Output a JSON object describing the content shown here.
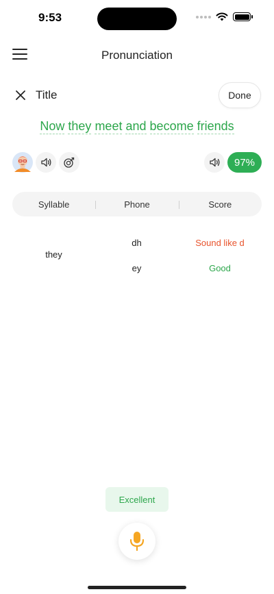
{
  "status_bar": {
    "time": "9:53",
    "battery_level_pct": 100
  },
  "nav": {
    "title": "Pronunciation",
    "menu_icon": "hamburger-menu-icon"
  },
  "title_row": {
    "title": "Title",
    "done_label": "Done",
    "close_icon": "close-icon"
  },
  "sentence": {
    "words": [
      "Now",
      "they",
      "meet",
      "and",
      "become",
      "friends"
    ],
    "color": "#2ca64b"
  },
  "controls": {
    "avatar_icon": "user-avatar",
    "left_buttons": [
      "speaker-icon",
      "record-playback-icon"
    ],
    "right_button": "speaker-icon",
    "score": "97%",
    "score_color": "#2eae55"
  },
  "table": {
    "headers": [
      "Syllable",
      "Phone",
      "Score"
    ],
    "rows": [
      {
        "syllable": "they",
        "phones": [
          {
            "phone": "dh",
            "score": "Sound like d",
            "color": "#e8532c"
          },
          {
            "phone": "ey",
            "score": "Good",
            "color": "#2ca64b"
          }
        ]
      }
    ]
  },
  "feedback": {
    "label": "Excellent"
  },
  "mic": {
    "icon": "microphone-icon",
    "color": "#f5a623"
  }
}
